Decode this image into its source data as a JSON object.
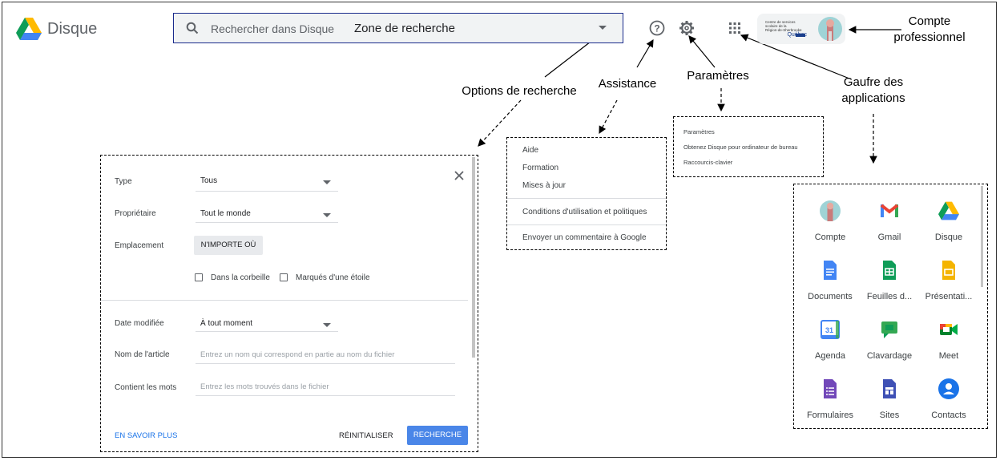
{
  "header": {
    "app_name": "Disque",
    "search_placeholder": "Rechercher dans Disque",
    "search_zone_label": "Zone de recherche",
    "account_org_line1": "Centre de services",
    "account_org_line2": "scolaire de la",
    "account_org_line3": "Région-de-Sherbrooke",
    "account_org_brand": "Québec"
  },
  "annotations": {
    "account": "Compte\nprofessionnel",
    "search_options": "Options de recherche",
    "assistance": "Assistance",
    "settings": "Paramètres",
    "waffle": "Gaufre des\napplications"
  },
  "search_options": {
    "type_label": "Type",
    "type_value": "Tous",
    "owner_label": "Propriétaire",
    "owner_value": "Tout le monde",
    "location_label": "Emplacement",
    "location_value": "N'IMPORTE OÙ",
    "trash_label": "Dans la corbeille",
    "starred_label": "Marqués d'une étoile",
    "date_label": "Date modifiée",
    "date_value": "À tout moment",
    "item_name_label": "Nom de l'article",
    "item_name_placeholder": "Entrez un nom qui correspond en partie au nom du fichier",
    "words_label": "Contient les mots",
    "words_placeholder": "Entrez les mots trouvés dans le fichier",
    "learn_more": "EN SAVOIR PLUS",
    "reset": "RÉINITIALISER",
    "search": "RECHERCHE"
  },
  "help_menu": {
    "items": [
      "Aide",
      "Formation",
      "Mises à jour",
      "Conditions d'utilisation et politiques",
      "Envoyer un commentaire à Google"
    ]
  },
  "settings_menu": {
    "items": [
      "Paramètres",
      "Obtenez Disque pour ordinateur de bureau",
      "Raccourcis-clavier"
    ]
  },
  "apps": [
    {
      "label": "Compte",
      "icon": "account-avatar-icon"
    },
    {
      "label": "Gmail",
      "icon": "gmail-icon"
    },
    {
      "label": "Disque",
      "icon": "drive-icon"
    },
    {
      "label": "Documents",
      "icon": "docs-icon"
    },
    {
      "label": "Feuilles d...",
      "icon": "sheets-icon"
    },
    {
      "label": "Présentati...",
      "icon": "slides-icon"
    },
    {
      "label": "Agenda",
      "icon": "calendar-icon"
    },
    {
      "label": "Clavardage",
      "icon": "chat-icon"
    },
    {
      "label": "Meet",
      "icon": "meet-icon"
    },
    {
      "label": "Formulaires",
      "icon": "forms-icon"
    },
    {
      "label": "Sites",
      "icon": "sites-icon"
    },
    {
      "label": "Contacts",
      "icon": "contacts-icon"
    }
  ],
  "calendar_day": "31"
}
